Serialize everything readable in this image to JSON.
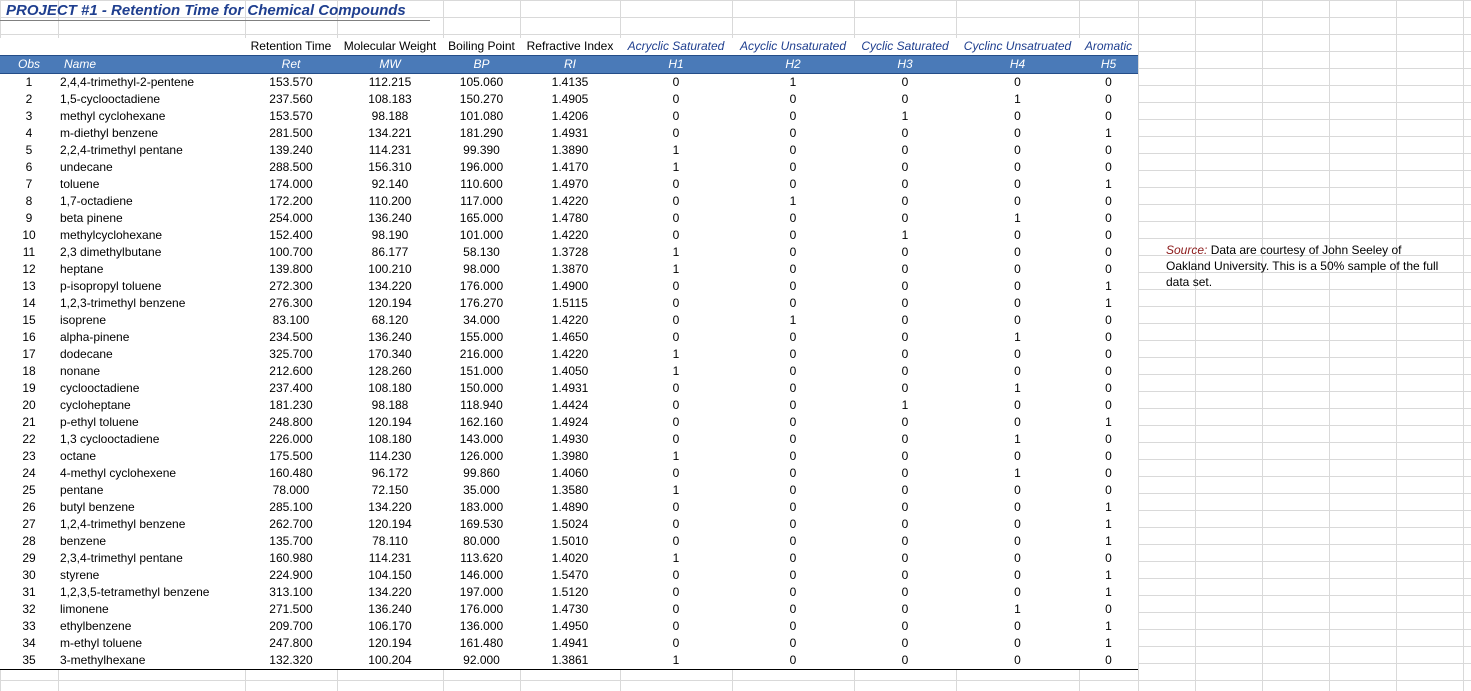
{
  "title": "PROJECT #1 - Retention Time for Chemical Compounds",
  "header_top": [
    "",
    "",
    "Retention Time",
    "Molecular Weight",
    "Boiling Point",
    "Refractive Index",
    "Acryclic Saturated",
    "Acyclic Unsaturated",
    "Cyclic Saturated",
    "Cyclinc Unsatruated",
    "Aromatic"
  ],
  "header_cols": [
    "Obs",
    "Name",
    "Ret",
    "MW",
    "BP",
    "RI",
    "H1",
    "H2",
    "H3",
    "H4",
    "H5"
  ],
  "rows": [
    [
      "1",
      "2,4,4-trimethyl-2-pentene",
      "153.570",
      "112.215",
      "105.060",
      "1.4135",
      "0",
      "1",
      "0",
      "0",
      "0"
    ],
    [
      "2",
      "1,5-cyclooctadiene",
      "237.560",
      "108.183",
      "150.270",
      "1.4905",
      "0",
      "0",
      "0",
      "1",
      "0"
    ],
    [
      "3",
      "methyl cyclohexane",
      "153.570",
      "98.188",
      "101.080",
      "1.4206",
      "0",
      "0",
      "1",
      "0",
      "0"
    ],
    [
      "4",
      "m-diethyl benzene",
      "281.500",
      "134.221",
      "181.290",
      "1.4931",
      "0",
      "0",
      "0",
      "0",
      "1"
    ],
    [
      "5",
      "2,2,4-trimethyl pentane",
      "139.240",
      "114.231",
      "99.390",
      "1.3890",
      "1",
      "0",
      "0",
      "0",
      "0"
    ],
    [
      "6",
      "undecane",
      "288.500",
      "156.310",
      "196.000",
      "1.4170",
      "1",
      "0",
      "0",
      "0",
      "0"
    ],
    [
      "7",
      "toluene",
      "174.000",
      "92.140",
      "110.600",
      "1.4970",
      "0",
      "0",
      "0",
      "0",
      "1"
    ],
    [
      "8",
      "1,7-octadiene",
      "172.200",
      "110.200",
      "117.000",
      "1.4220",
      "0",
      "1",
      "0",
      "0",
      "0"
    ],
    [
      "9",
      "beta pinene",
      "254.000",
      "136.240",
      "165.000",
      "1.4780",
      "0",
      "0",
      "0",
      "1",
      "0"
    ],
    [
      "10",
      "methylcyclohexane",
      "152.400",
      "98.190",
      "101.000",
      "1.4220",
      "0",
      "0",
      "1",
      "0",
      "0"
    ],
    [
      "11",
      "2,3 dimethylbutane",
      "100.700",
      "86.177",
      "58.130",
      "1.3728",
      "1",
      "0",
      "0",
      "0",
      "0"
    ],
    [
      "12",
      "heptane",
      "139.800",
      "100.210",
      "98.000",
      "1.3870",
      "1",
      "0",
      "0",
      "0",
      "0"
    ],
    [
      "13",
      "p-isopropyl toluene",
      "272.300",
      "134.220",
      "176.000",
      "1.4900",
      "0",
      "0",
      "0",
      "0",
      "1"
    ],
    [
      "14",
      "1,2,3-trimethyl benzene",
      "276.300",
      "120.194",
      "176.270",
      "1.5115",
      "0",
      "0",
      "0",
      "0",
      "1"
    ],
    [
      "15",
      "isoprene",
      "83.100",
      "68.120",
      "34.000",
      "1.4220",
      "0",
      "1",
      "0",
      "0",
      "0"
    ],
    [
      "16",
      "alpha-pinene",
      "234.500",
      "136.240",
      "155.000",
      "1.4650",
      "0",
      "0",
      "0",
      "1",
      "0"
    ],
    [
      "17",
      "dodecane",
      "325.700",
      "170.340",
      "216.000",
      "1.4220",
      "1",
      "0",
      "0",
      "0",
      "0"
    ],
    [
      "18",
      "nonane",
      "212.600",
      "128.260",
      "151.000",
      "1.4050",
      "1",
      "0",
      "0",
      "0",
      "0"
    ],
    [
      "19",
      "cyclooctadiene",
      "237.400",
      "108.180",
      "150.000",
      "1.4931",
      "0",
      "0",
      "0",
      "1",
      "0"
    ],
    [
      "20",
      "cycloheptane",
      "181.230",
      "98.188",
      "118.940",
      "1.4424",
      "0",
      "0",
      "1",
      "0",
      "0"
    ],
    [
      "21",
      "p-ethyl toluene",
      "248.800",
      "120.194",
      "162.160",
      "1.4924",
      "0",
      "0",
      "0",
      "0",
      "1"
    ],
    [
      "22",
      "1,3 cyclooctadiene",
      "226.000",
      "108.180",
      "143.000",
      "1.4930",
      "0",
      "0",
      "0",
      "1",
      "0"
    ],
    [
      "23",
      "octane",
      "175.500",
      "114.230",
      "126.000",
      "1.3980",
      "1",
      "0",
      "0",
      "0",
      "0"
    ],
    [
      "24",
      "4-methyl cyclohexene",
      "160.480",
      "96.172",
      "99.860",
      "1.4060",
      "0",
      "0",
      "0",
      "1",
      "0"
    ],
    [
      "25",
      "pentane",
      "78.000",
      "72.150",
      "35.000",
      "1.3580",
      "1",
      "0",
      "0",
      "0",
      "0"
    ],
    [
      "26",
      "butyl benzene",
      "285.100",
      "134.220",
      "183.000",
      "1.4890",
      "0",
      "0",
      "0",
      "0",
      "1"
    ],
    [
      "27",
      "1,2,4-trimethyl benzene",
      "262.700",
      "120.194",
      "169.530",
      "1.5024",
      "0",
      "0",
      "0",
      "0",
      "1"
    ],
    [
      "28",
      "benzene",
      "135.700",
      "78.110",
      "80.000",
      "1.5010",
      "0",
      "0",
      "0",
      "0",
      "1"
    ],
    [
      "29",
      "2,3,4-trimethyl pentane",
      "160.980",
      "114.231",
      "113.620",
      "1.4020",
      "1",
      "0",
      "0",
      "0",
      "0"
    ],
    [
      "30",
      "styrene",
      "224.900",
      "104.150",
      "146.000",
      "1.5470",
      "0",
      "0",
      "0",
      "0",
      "1"
    ],
    [
      "31",
      "1,2,3,5-tetramethyl benzene",
      "313.100",
      "134.220",
      "197.000",
      "1.5120",
      "0",
      "0",
      "0",
      "0",
      "1"
    ],
    [
      "32",
      "limonene",
      "271.500",
      "136.240",
      "176.000",
      "1.4730",
      "0",
      "0",
      "0",
      "1",
      "0"
    ],
    [
      "33",
      "ethylbenzene",
      "209.700",
      "106.170",
      "136.000",
      "1.4950",
      "0",
      "0",
      "0",
      "0",
      "1"
    ],
    [
      "34",
      "m-ethyl toluene",
      "247.800",
      "120.194",
      "161.480",
      "1.4941",
      "0",
      "0",
      "0",
      "0",
      "1"
    ],
    [
      "35",
      "3-methylhexane",
      "132.320",
      "100.204",
      "92.000",
      "1.3861",
      "1",
      "0",
      "0",
      "0",
      "0"
    ]
  ],
  "source": {
    "label": "Source:",
    "text": "Data are courtesy of John Seeley of Oakland University.  This is a 50% sample of the full data set."
  },
  "colors": {
    "header_fill": "#4a7ab8",
    "title_text": "#1f3f8f",
    "source_label": "#8b1a1a",
    "gridline": "#d9d9d9"
  }
}
